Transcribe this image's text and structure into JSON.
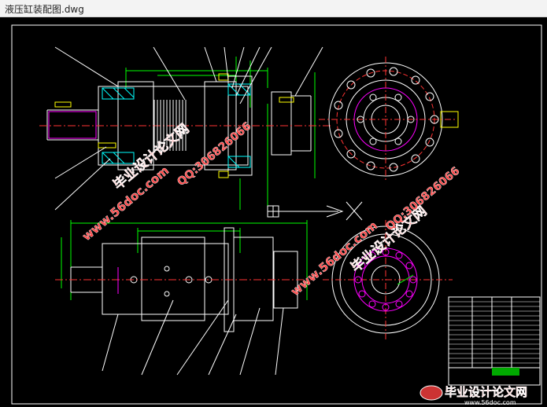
{
  "window": {
    "title": "液压缸装配图.dwg"
  },
  "drawing": {
    "background": "#000000",
    "colors": {
      "outline": "#ffffff",
      "dim": "#00ff00",
      "center": "#ff3333",
      "holes": "#ff00ff",
      "cyan": "#00ffff",
      "yellow": "#ffff00"
    }
  },
  "watermarks": [
    {
      "text": "毕业设计论文网"
    },
    {
      "text": "www.56doc.com"
    },
    {
      "text": "QQ:306826066"
    },
    {
      "text": "毕业设计论文网"
    },
    {
      "text": "www.56doc.com"
    },
    {
      "text": "QQ:306826066"
    }
  ],
  "logo": {
    "text": "毕业设计论文网",
    "url": "www.56doc.com"
  }
}
